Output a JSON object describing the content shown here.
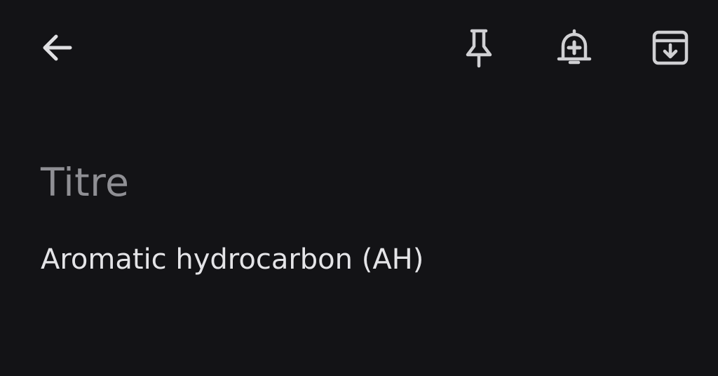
{
  "toolbar": {
    "back_icon": "arrow-back-icon",
    "pin_icon": "pin-icon",
    "reminder_icon": "bell-add-icon",
    "archive_icon": "archive-icon"
  },
  "note": {
    "title_placeholder": "Titre",
    "body_text": "Aromatic hydrocarbon (AH)"
  },
  "colors": {
    "background": "#131316",
    "icon": "#d7d7da",
    "title_placeholder": "#8f8f94",
    "body_text": "#e4e4e7"
  }
}
